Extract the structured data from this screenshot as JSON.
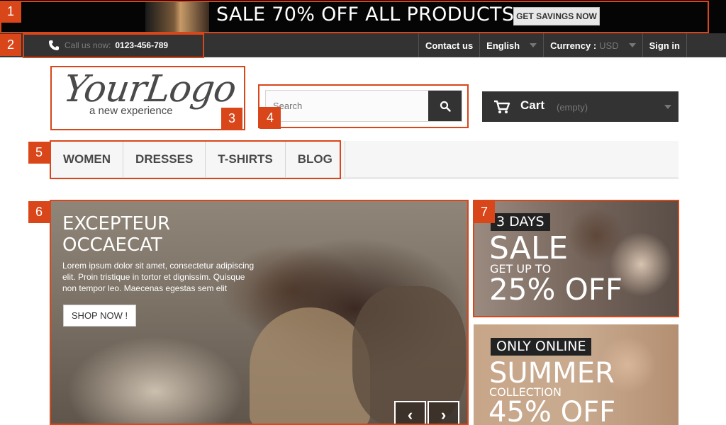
{
  "promo": {
    "text": "SALE 70% OFF ALL PRODUCTS",
    "button": "GET SAVINGS NOW"
  },
  "topbar": {
    "call_label": "Call us now:",
    "phone": "0123-456-789",
    "contact": "Contact us",
    "language": "English",
    "currency_label": "Currency :",
    "currency_value": "USD",
    "sign_in": "Sign in"
  },
  "logo": {
    "main": "YourLogo",
    "sub": "a new experience"
  },
  "search": {
    "placeholder": "Search"
  },
  "cart": {
    "label": "Cart",
    "status": "(empty)"
  },
  "menu": {
    "items": [
      {
        "label": "WOMEN"
      },
      {
        "label": "DRESSES"
      },
      {
        "label": "T-SHIRTS"
      },
      {
        "label": "BLOG"
      }
    ]
  },
  "slider": {
    "title_line1": "EXCEPTEUR",
    "title_line2": "OCCAECAT",
    "text": "Lorem ipsum dolor sit amet, consectetur adipiscing elit. Proin tristique in tortor et dignissim. Quisque non tempor leo. Maecenas egestas sem elit",
    "button": "SHOP NOW !",
    "prev": "‹",
    "next": "›"
  },
  "banners": [
    {
      "tag": "3 DAYS",
      "line1": "SALE",
      "line2": "GET UP TO",
      "line3": "25% OFF"
    },
    {
      "tag": "ONLY ONLINE",
      "line1": "SUMMER",
      "line2": "COLLECTION",
      "line3": "45% OFF"
    }
  ],
  "annotations": [
    "1",
    "2",
    "3",
    "4",
    "5",
    "6",
    "7"
  ],
  "colors": {
    "accent": "#d9461a",
    "dark": "#333333",
    "menu_bg": "#f6f6f6"
  }
}
